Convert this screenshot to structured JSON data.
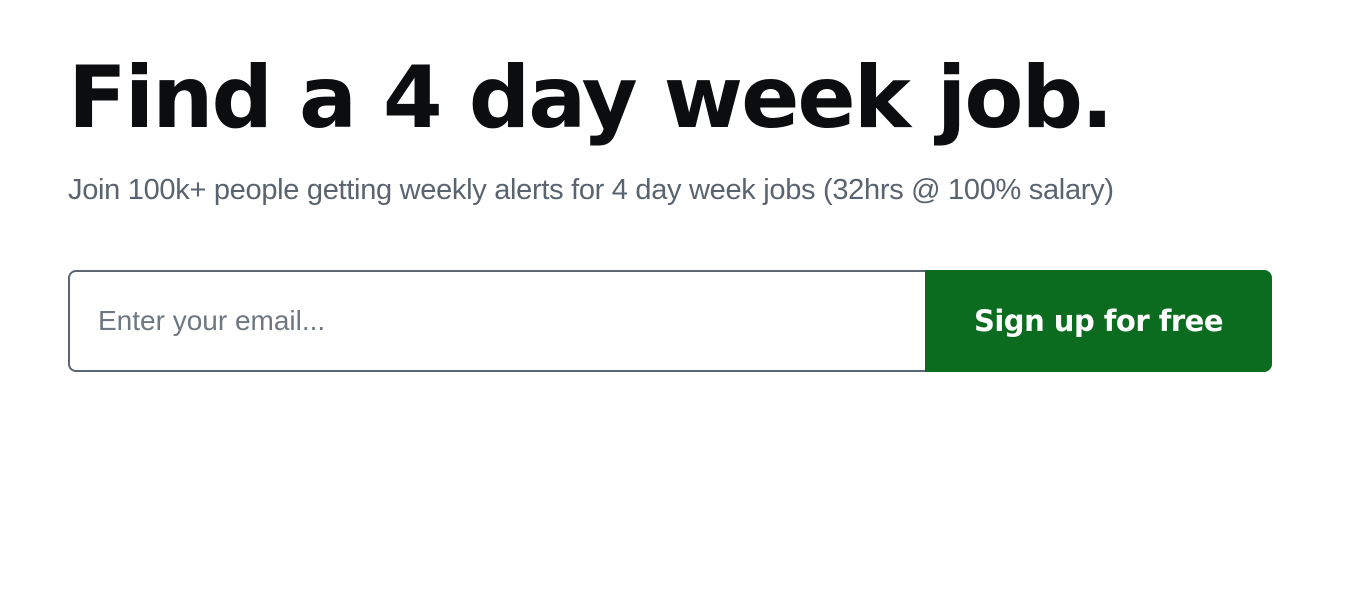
{
  "hero": {
    "headline": "Find a 4 day week job.",
    "subtitle": "Join 100k+ people getting weekly alerts for 4 day week jobs (32hrs @ 100% salary)"
  },
  "signup": {
    "email_placeholder": "Enter your email...",
    "email_value": "",
    "button_label": "Sign up for free"
  },
  "colors": {
    "accent": "#0b6b1f",
    "headline": "#0b0d0e",
    "subtitle": "#5a6470",
    "input_border": "#5b6672"
  }
}
